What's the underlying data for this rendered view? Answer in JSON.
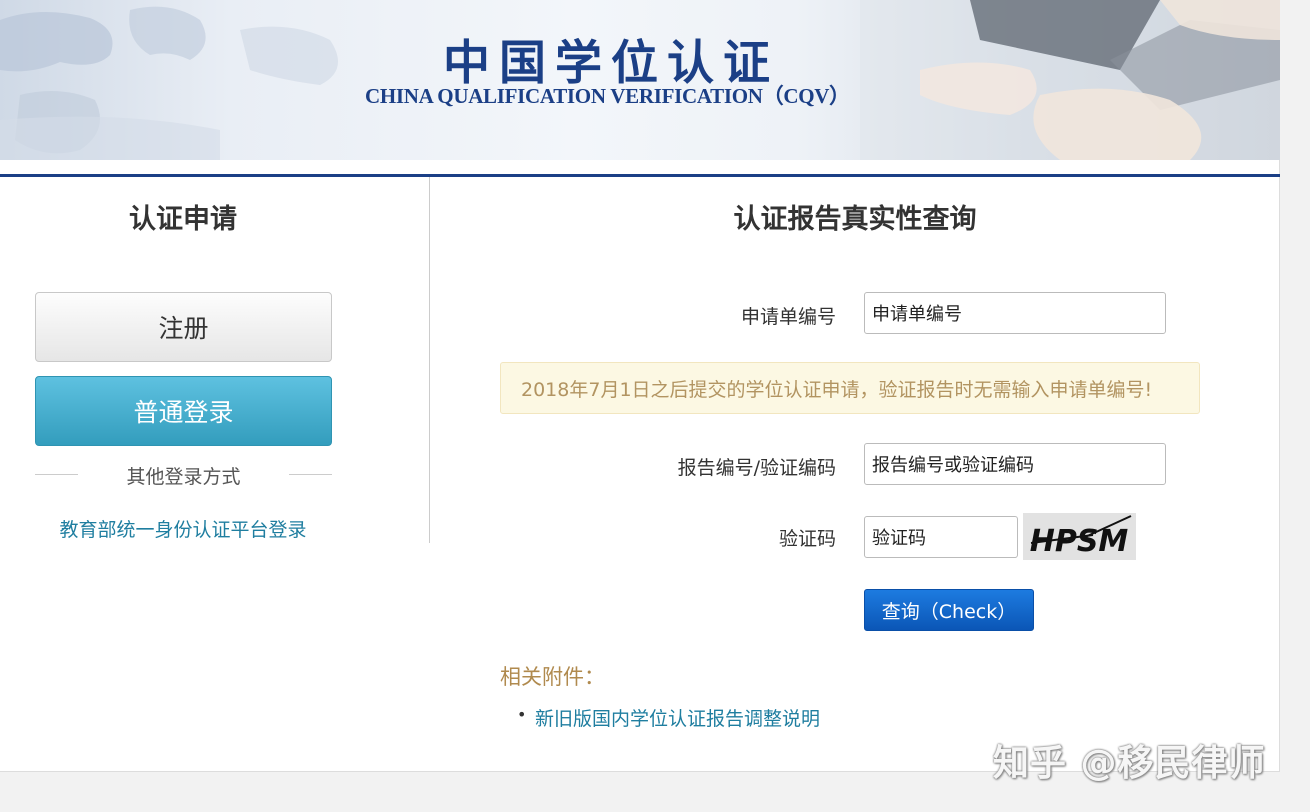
{
  "banner": {
    "title": "中国学位认证",
    "subtitle": "CHINA QUALIFICATION VERIFICATION（CQV）"
  },
  "left": {
    "heading": "认证申请",
    "register_label": "注册",
    "login_label": "普通登录",
    "other_methods": "其他登录方式",
    "edu_login_link": "教育部统一身份认证平台登录"
  },
  "query": {
    "heading": "认证报告真实性查询",
    "app_no_label": "申请单编号",
    "app_no_placeholder": "申请单编号",
    "notice": "2018年7月1日之后提交的学位认证申请，验证报告时无需输入申请单编号!",
    "report_no_label": "报告编号/验证编码",
    "report_no_placeholder": "报告编号或验证编码",
    "captcha_label": "验证码",
    "captcha_placeholder": "验证码",
    "captcha_image_text": "HPSM",
    "check_label": "查询（Check）"
  },
  "attachments": {
    "heading": "相关附件：",
    "items": [
      "新旧版国内学位认证报告调整说明"
    ]
  },
  "watermark": "知乎 @移民律师",
  "colors": {
    "brand_navy": "#1b3f86",
    "login_button": "#3fa9c9",
    "check_button": "#0b62c8",
    "notice_bg": "#fcf8e3",
    "notice_text": "#b29461",
    "link": "#1f7ea0"
  }
}
